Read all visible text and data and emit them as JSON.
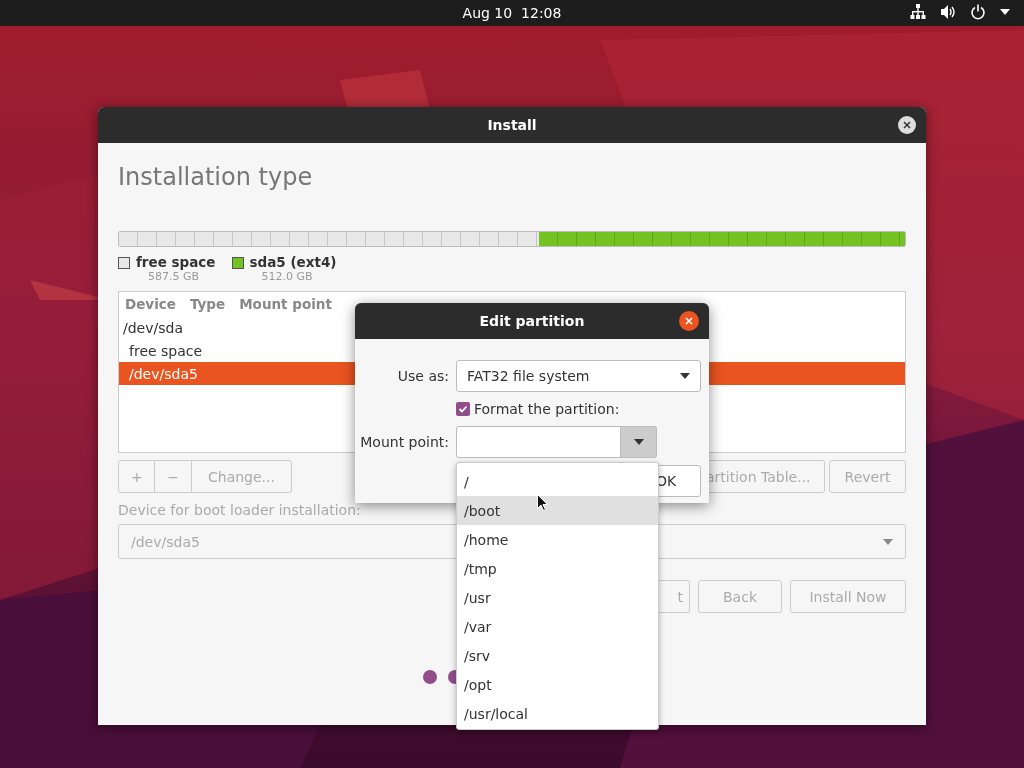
{
  "topbar": {
    "clock": "Aug 10  12:08"
  },
  "window": {
    "title": "Install",
    "heading": "Installation type"
  },
  "partitions": [
    {
      "name": "free space",
      "size": "587.5 GB",
      "color": "#e8e8e8"
    },
    {
      "name": "sda5 (ext4)",
      "size": "512.0 GB",
      "color": "#73c322"
    }
  ],
  "table": {
    "columns": [
      "Device",
      "Type",
      "Mount point"
    ],
    "rows": [
      {
        "device": "/dev/sda",
        "selected": false,
        "children": [
          {
            "device": "free space",
            "selected": false
          },
          {
            "device": "/dev/sda5",
            "selected": true
          }
        ]
      }
    ]
  },
  "table_buttons": [
    "+",
    "−",
    "Change..."
  ],
  "side_buttons": [
    "artition Table...",
    "Revert"
  ],
  "boot_loader": {
    "label": "Device for boot loader installation:",
    "value": "/dev/sda5"
  },
  "nav_buttons": [
    "t",
    "Back",
    "Install Now"
  ],
  "dialog": {
    "title": "Edit partition",
    "use_as_label": "Use as:",
    "use_as_value": "FAT32 file system",
    "format_label": "Format the partition:",
    "format_checked": true,
    "mount_label": "Mount point:",
    "ok": "OK"
  },
  "dropdown": [
    {
      "label": "/",
      "selected": false
    },
    {
      "label": "/boot",
      "selected": true
    },
    {
      "label": "/home",
      "selected": false
    },
    {
      "label": "/tmp",
      "selected": false
    },
    {
      "label": "/usr",
      "selected": false
    },
    {
      "label": "/var",
      "selected": false
    },
    {
      "label": "/srv",
      "selected": false
    },
    {
      "label": "/opt",
      "selected": false
    },
    {
      "label": "/usr/local",
      "selected": false
    }
  ]
}
